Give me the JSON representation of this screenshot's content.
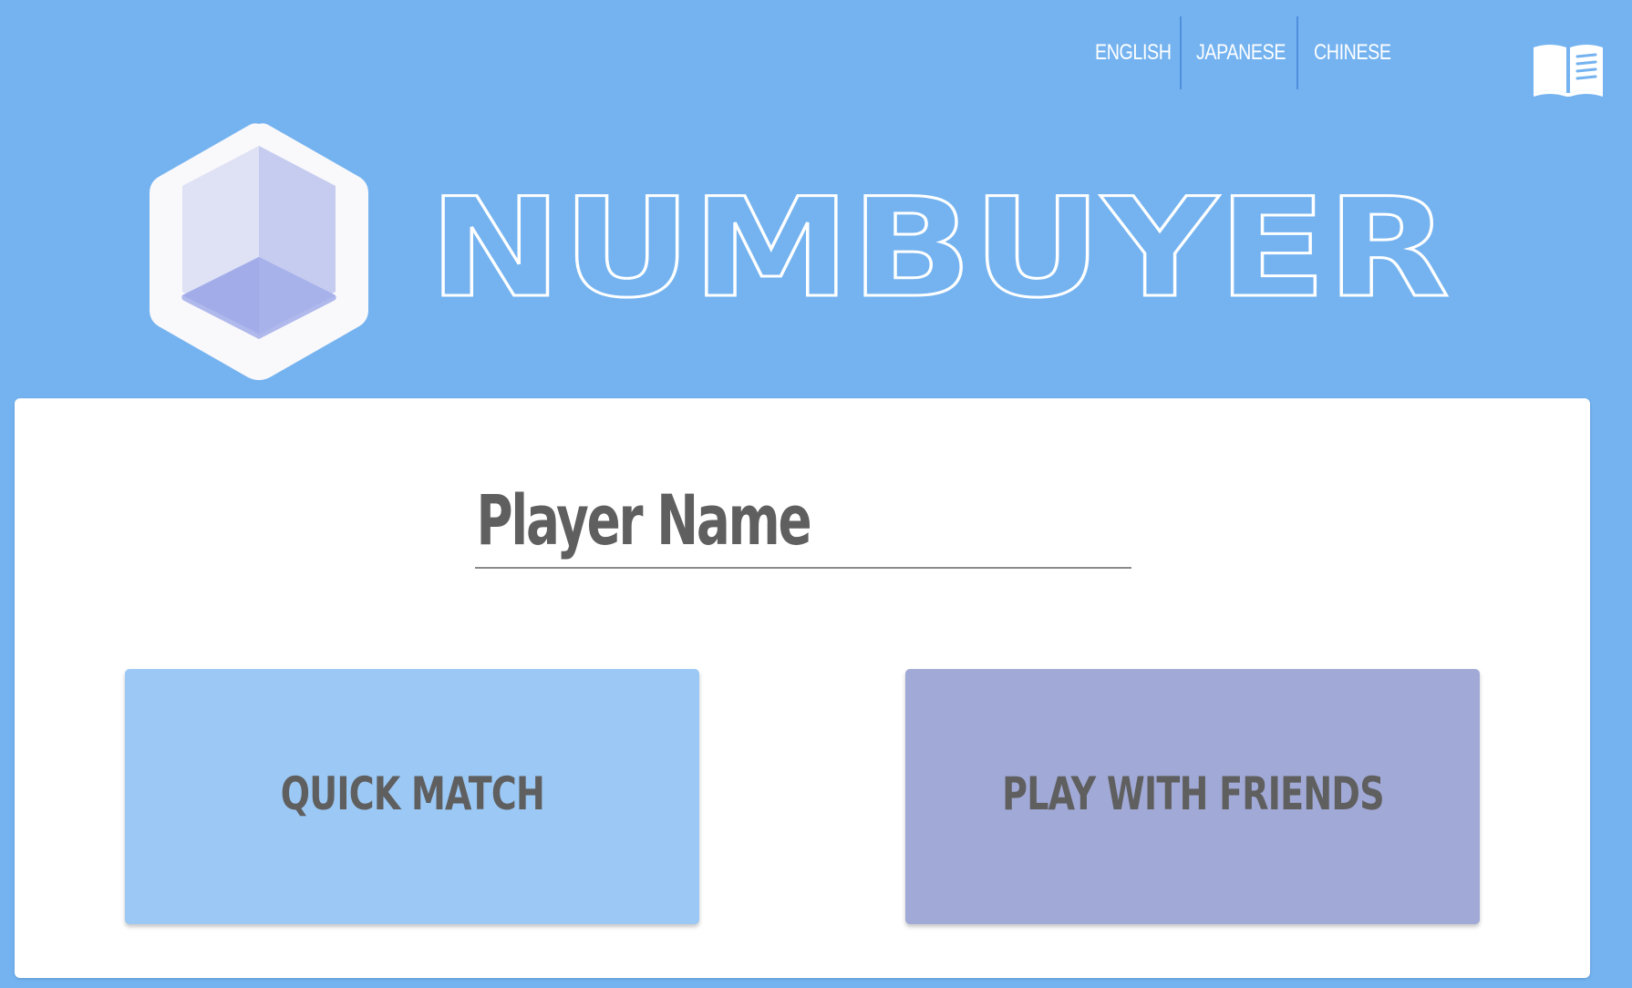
{
  "header": {
    "languages": [
      {
        "label": "ENGLISH"
      },
      {
        "label": "JAPANESE"
      },
      {
        "label": "CHINESE"
      }
    ],
    "help_icon": "open-book-icon"
  },
  "logo": {
    "wordmark": "NUMBUYER",
    "mark_icon": "hexagon-cube-icon"
  },
  "form": {
    "player_name_placeholder": "Player Name",
    "player_name_value": ""
  },
  "actions": {
    "quick_match_label": "QUICK MATCH",
    "play_with_friends_label": "PLAY WITH FRIENDS"
  },
  "colors": {
    "background": "#74b3f0",
    "card": "#ffffff",
    "quick_match": "#9bc8f4",
    "play_with_friends": "#a1a9d6",
    "text": "#5f5f5f"
  }
}
